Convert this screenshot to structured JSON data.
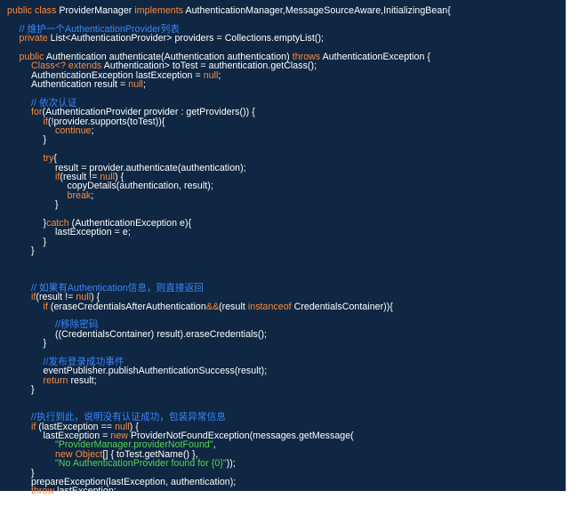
{
  "code": {
    "lines": [
      {
        "indent": 0,
        "tokens": [
          {
            "t": "public class ",
            "c": "kw"
          },
          {
            "t": "ProviderManager ",
            "c": "id"
          },
          {
            "t": "implements ",
            "c": "kw"
          },
          {
            "t": "AuthenticationManager,MessageSourceAware,InitializingBean{",
            "c": "id"
          }
        ]
      },
      {
        "indent": 0,
        "tokens": []
      },
      {
        "indent": 1,
        "tokens": [
          {
            "t": "// 维护一个AuthenticationProvider列表",
            "c": "cm"
          }
        ]
      },
      {
        "indent": 1,
        "tokens": [
          {
            "t": "private ",
            "c": "kw"
          },
          {
            "t": "List<AuthenticationProvider> providers = Collections.emptyList();",
            "c": "id"
          }
        ]
      },
      {
        "indent": 0,
        "tokens": []
      },
      {
        "indent": 1,
        "tokens": [
          {
            "t": "public ",
            "c": "kw"
          },
          {
            "t": "Authentication authenticate(Authentication authentication) ",
            "c": "id"
          },
          {
            "t": "throws ",
            "c": "kw"
          },
          {
            "t": "AuthenticationException {",
            "c": "id"
          }
        ]
      },
      {
        "indent": 2,
        "tokens": [
          {
            "t": "Class<? ",
            "c": "kw"
          },
          {
            "t": "extends ",
            "c": "kw"
          },
          {
            "t": "Authentication> toTest = authentication.getClass();",
            "c": "id"
          }
        ]
      },
      {
        "indent": 2,
        "tokens": [
          {
            "t": "AuthenticationException lastException = ",
            "c": "id"
          },
          {
            "t": "null",
            "c": "kw"
          },
          {
            "t": ";",
            "c": "id"
          }
        ]
      },
      {
        "indent": 2,
        "tokens": [
          {
            "t": "Authentication result = ",
            "c": "id"
          },
          {
            "t": "null",
            "c": "kw"
          },
          {
            "t": ";",
            "c": "id"
          }
        ]
      },
      {
        "indent": 0,
        "tokens": []
      },
      {
        "indent": 2,
        "tokens": [
          {
            "t": "// 依次认证",
            "c": "cm"
          }
        ]
      },
      {
        "indent": 2,
        "tokens": [
          {
            "t": "for",
            "c": "kw"
          },
          {
            "t": "(AuthenticationProvider provider : getProviders()) {",
            "c": "id"
          }
        ]
      },
      {
        "indent": 3,
        "tokens": [
          {
            "t": "if",
            "c": "kw"
          },
          {
            "t": "(!provider.supports(toTest)){",
            "c": "id"
          }
        ]
      },
      {
        "indent": 4,
        "tokens": [
          {
            "t": "continue",
            "c": "kw"
          },
          {
            "t": ";",
            "c": "id"
          }
        ]
      },
      {
        "indent": 3,
        "tokens": [
          {
            "t": "}",
            "c": "id"
          }
        ]
      },
      {
        "indent": 0,
        "tokens": []
      },
      {
        "indent": 3,
        "tokens": [
          {
            "t": "try",
            "c": "kw"
          },
          {
            "t": "{",
            "c": "id"
          }
        ]
      },
      {
        "indent": 4,
        "tokens": [
          {
            "t": "result = provider.authenticate(authentication);",
            "c": "id"
          }
        ]
      },
      {
        "indent": 4,
        "tokens": [
          {
            "t": "if",
            "c": "kw"
          },
          {
            "t": "(result != ",
            "c": "id"
          },
          {
            "t": "null",
            "c": "kw"
          },
          {
            "t": ") {",
            "c": "id"
          }
        ]
      },
      {
        "indent": 5,
        "tokens": [
          {
            "t": "copyDetails(authentication, result);",
            "c": "id"
          }
        ]
      },
      {
        "indent": 5,
        "tokens": [
          {
            "t": "break",
            "c": "kw"
          },
          {
            "t": ";",
            "c": "id"
          }
        ]
      },
      {
        "indent": 4,
        "tokens": [
          {
            "t": "}",
            "c": "id"
          }
        ]
      },
      {
        "indent": 0,
        "tokens": []
      },
      {
        "indent": 3,
        "tokens": [
          {
            "t": "}",
            "c": "id"
          },
          {
            "t": "catch ",
            "c": "kw"
          },
          {
            "t": "(AuthenticationException e){",
            "c": "id"
          }
        ]
      },
      {
        "indent": 4,
        "tokens": [
          {
            "t": "lastException = e;",
            "c": "id"
          }
        ]
      },
      {
        "indent": 3,
        "tokens": [
          {
            "t": "}",
            "c": "id"
          }
        ]
      },
      {
        "indent": 2,
        "tokens": [
          {
            "t": "}",
            "c": "id"
          }
        ]
      },
      {
        "indent": 0,
        "tokens": []
      },
      {
        "indent": 0,
        "tokens": []
      },
      {
        "indent": 0,
        "tokens": []
      },
      {
        "indent": 2,
        "tokens": [
          {
            "t": "// 如果有Authentication信息，则直接返回",
            "c": "cm"
          }
        ]
      },
      {
        "indent": 2,
        "tokens": [
          {
            "t": "if",
            "c": "kw"
          },
          {
            "t": "(result != ",
            "c": "id"
          },
          {
            "t": "null",
            "c": "kw"
          },
          {
            "t": ") {",
            "c": "id"
          }
        ]
      },
      {
        "indent": 3,
        "tokens": [
          {
            "t": "if ",
            "c": "kw"
          },
          {
            "t": "(eraseCredentialsAfterAuthentication",
            "c": "id"
          },
          {
            "t": "&&",
            "c": "kw"
          },
          {
            "t": "(result ",
            "c": "id"
          },
          {
            "t": "instanceof ",
            "c": "kw"
          },
          {
            "t": "CredentialsContainer)){",
            "c": "id"
          }
        ]
      },
      {
        "indent": 0,
        "tokens": []
      },
      {
        "indent": 4,
        "tokens": [
          {
            "t": "//移除密码",
            "c": "cm"
          }
        ]
      },
      {
        "indent": 4,
        "tokens": [
          {
            "t": "((CredentialsContainer) result).eraseCredentials();",
            "c": "id"
          }
        ]
      },
      {
        "indent": 3,
        "tokens": [
          {
            "t": "}",
            "c": "id"
          }
        ]
      },
      {
        "indent": 0,
        "tokens": []
      },
      {
        "indent": 3,
        "tokens": [
          {
            "t": "//发布登录成功事件",
            "c": "cm"
          }
        ]
      },
      {
        "indent": 3,
        "tokens": [
          {
            "t": "eventPublisher.publishAuthenticationSuccess(result);",
            "c": "id"
          }
        ]
      },
      {
        "indent": 3,
        "tokens": [
          {
            "t": "return ",
            "c": "kw"
          },
          {
            "t": "result;",
            "c": "id"
          }
        ]
      },
      {
        "indent": 2,
        "tokens": [
          {
            "t": "}",
            "c": "id"
          }
        ]
      },
      {
        "indent": 0,
        "tokens": []
      },
      {
        "indent": 0,
        "tokens": []
      },
      {
        "indent": 2,
        "tokens": [
          {
            "t": "//执行到此，说明没有认证成功，包装异常信息",
            "c": "cm"
          }
        ]
      },
      {
        "indent": 2,
        "tokens": [
          {
            "t": "if ",
            "c": "kw"
          },
          {
            "t": "(lastException == ",
            "c": "id"
          },
          {
            "t": "null",
            "c": "kw"
          },
          {
            "t": ") {",
            "c": "id"
          }
        ]
      },
      {
        "indent": 3,
        "tokens": [
          {
            "t": "lastException = ",
            "c": "id"
          },
          {
            "t": "new ",
            "c": "kw"
          },
          {
            "t": "ProviderNotFoundException(messages.getMessage(",
            "c": "id"
          }
        ]
      },
      {
        "indent": 4,
        "tokens": [
          {
            "t": "\"ProviderManager.providerNotFound\"",
            "c": "st"
          },
          {
            "t": ",",
            "c": "id"
          }
        ]
      },
      {
        "indent": 4,
        "tokens": [
          {
            "t": "new ",
            "c": "kw"
          },
          {
            "t": "Object",
            "c": "kw"
          },
          {
            "t": "[] { toTest.getName() },",
            "c": "id"
          }
        ]
      },
      {
        "indent": 4,
        "tokens": [
          {
            "t": "\"No AuthenticationProvider found for {0}\"",
            "c": "st"
          },
          {
            "t": "));",
            "c": "id"
          }
        ]
      },
      {
        "indent": 2,
        "tokens": [
          {
            "t": "}",
            "c": "id"
          }
        ]
      },
      {
        "indent": 2,
        "tokens": [
          {
            "t": "prepareException(lastException, authentication);",
            "c": "id"
          }
        ]
      },
      {
        "indent": 2,
        "tokens": [
          {
            "t": "throw ",
            "c": "kw"
          },
          {
            "t": "lastException;",
            "c": "id"
          }
        ]
      },
      {
        "indent": 1,
        "tokens": [
          {
            "t": "}",
            "c": "id"
          }
        ]
      },
      {
        "indent": 0,
        "tokens": [
          {
            "t": "}",
            "c": "id"
          }
        ]
      }
    ]
  }
}
